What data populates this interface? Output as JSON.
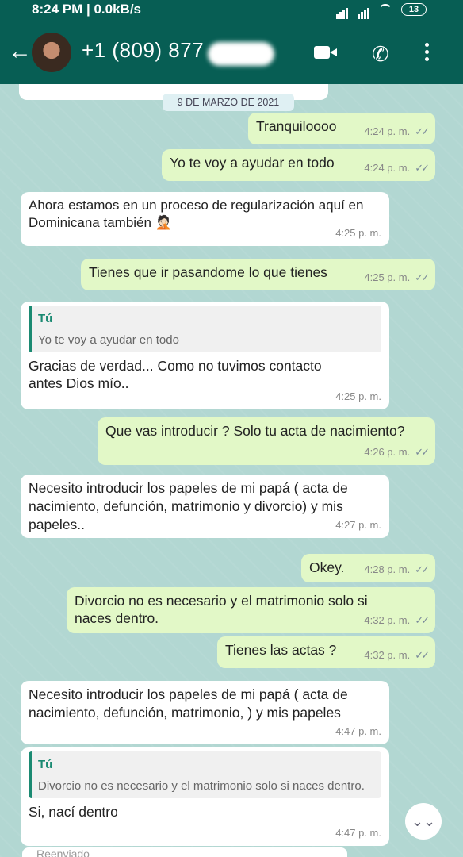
{
  "status_bar": {
    "time": "8:24 PM | 0.0kB/s",
    "extra_icons": "⌁ ···",
    "battery": "13"
  },
  "header": {
    "contact_name": "+1 (809) 877"
  },
  "date_badge": "9 DE MARZO DE 2021",
  "messages": [
    {
      "type": "out",
      "text": "Tranquiloooo",
      "time": "4:24 p. m."
    },
    {
      "type": "out",
      "text": "Yo te voy a ayudar en todo",
      "time": "4:24 p. m."
    },
    {
      "type": "in",
      "text": "Ahora estamos en un proceso de regularización aquí en Dominicana también 🤦🏻",
      "time": "4:25 p. m."
    },
    {
      "type": "out",
      "text": "Tienes que ir pasandome lo que tienes",
      "time": "4:25 p. m."
    },
    {
      "type": "in",
      "quote_name": "Tú",
      "quote_text": "Yo te voy a ayudar en todo",
      "text": "Gracias de verdad... Como no tuvimos contacto antes Dios mío..",
      "time": "4:25 p. m."
    },
    {
      "type": "out",
      "text": "Que vas introducir ? Solo tu acta de nacimiento?",
      "time": "4:26 p. m."
    },
    {
      "type": "in",
      "text": "Necesito introducir los papeles de mi papá ( acta de nacimiento, defunción, matrimonio y divorcio) y mis papeles..",
      "time": "4:27 p. m."
    },
    {
      "type": "out",
      "text": "Okey.",
      "time": "4:28 p. m."
    },
    {
      "type": "out",
      "text": "Divorcio no es necesario y el matrimonio solo si naces dentro.",
      "time": "4:32 p. m."
    },
    {
      "type": "out",
      "text": "Tienes las actas ?",
      "time": "4:32 p. m."
    },
    {
      "type": "in",
      "text": "Necesito introducir los papeles de mi papá ( acta de nacimiento, defunción, matrimonio, ) y mis papeles",
      "time": "4:47 p. m."
    },
    {
      "type": "in",
      "quote_name": "Tú",
      "quote_text": "Divorcio no es necesario y el matrimonio solo si naces dentro.",
      "text": "Si, nací dentro",
      "time": "4:47 p. m."
    }
  ],
  "forwarded_label": "Reenviado",
  "colors": {
    "header": "#075e54",
    "outgoing": "#e2f8c7",
    "incoming": "#ffffff",
    "quote_accent": "#1b8a72"
  }
}
